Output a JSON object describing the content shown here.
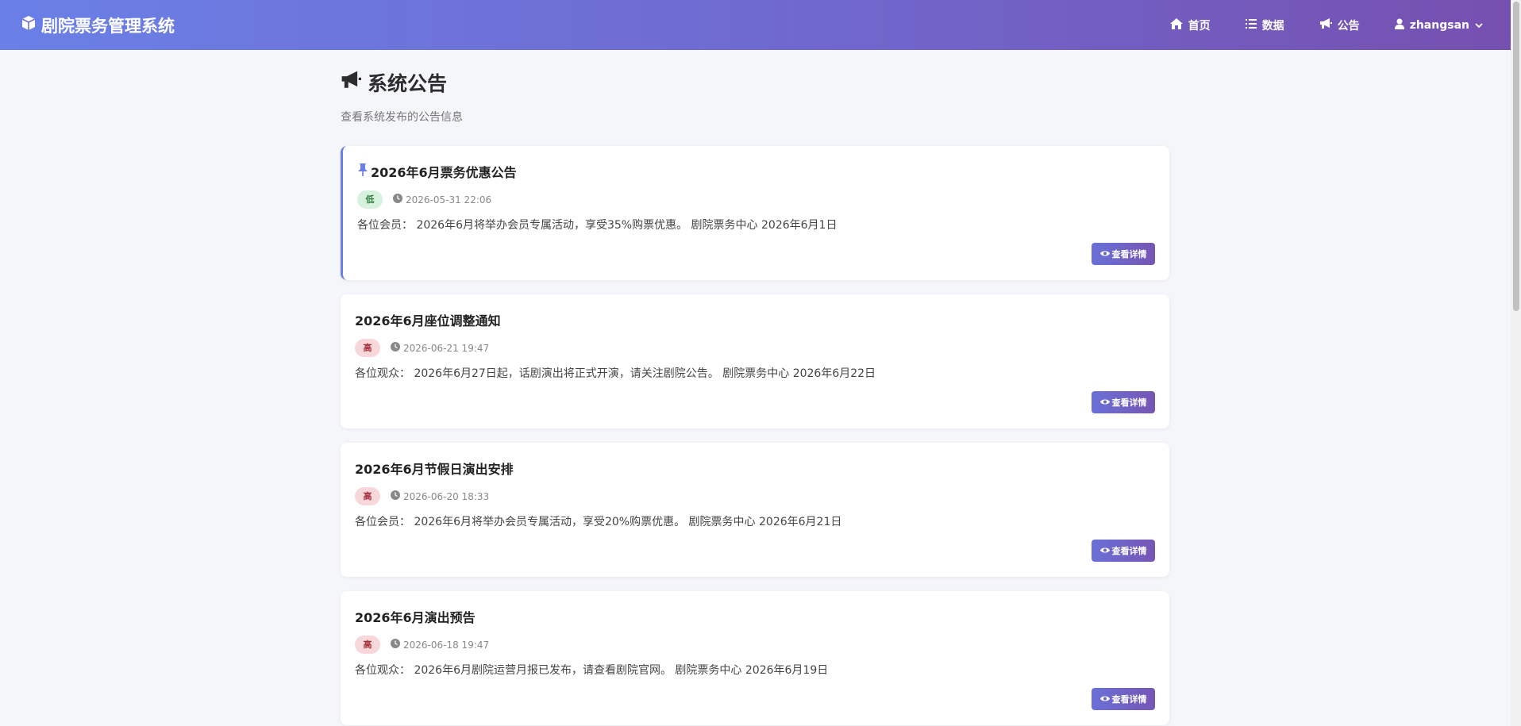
{
  "navbar": {
    "brand": "剧院票务管理系统",
    "items": [
      {
        "label": "首页",
        "icon": "home-icon"
      },
      {
        "label": "数据",
        "icon": "list-icon"
      },
      {
        "label": "公告",
        "icon": "megaphone-icon"
      }
    ],
    "user": "zhangsan"
  },
  "page": {
    "title": "系统公告",
    "subtitle": "查看系统发布的公告信息"
  },
  "detail_label": "查看详情",
  "announcements": [
    {
      "title": "2026年6月票务优惠公告",
      "pinned": true,
      "priority": "低",
      "priority_level": "low",
      "time": "2026-05-31 22:06",
      "content": "各位会员： 2026年6月将举办会员专属活动，享受35%购票优惠。 剧院票务中心 2026年6月1日"
    },
    {
      "title": "2026年6月座位调整通知",
      "pinned": false,
      "priority": "高",
      "priority_level": "high",
      "time": "2026-06-21 19:47",
      "content": "各位观众： 2026年6月27日起，话剧演出将正式开演，请关注剧院公告。 剧院票务中心 2026年6月22日"
    },
    {
      "title": "2026年6月节假日演出安排",
      "pinned": false,
      "priority": "高",
      "priority_level": "high",
      "time": "2026-06-20 18:33",
      "content": "各位会员： 2026年6月将举办会员专属活动，享受20%购票优惠。 剧院票务中心 2026年6月21日"
    },
    {
      "title": "2026年6月演出预告",
      "pinned": false,
      "priority": "高",
      "priority_level": "high",
      "time": "2026-06-18 19:47",
      "content": "各位观众： 2026年6月剧院运营月报已发布，请查看剧院官网。 剧院票务中心 2026年6月19日"
    }
  ],
  "colors": {
    "nav_gradient_start": "#6a80e6",
    "nav_gradient_end": "#7650b0",
    "pin_accent": "#6b7fe3",
    "badge_low_bg": "#d7f1df",
    "badge_high_bg": "#f8d7da"
  }
}
